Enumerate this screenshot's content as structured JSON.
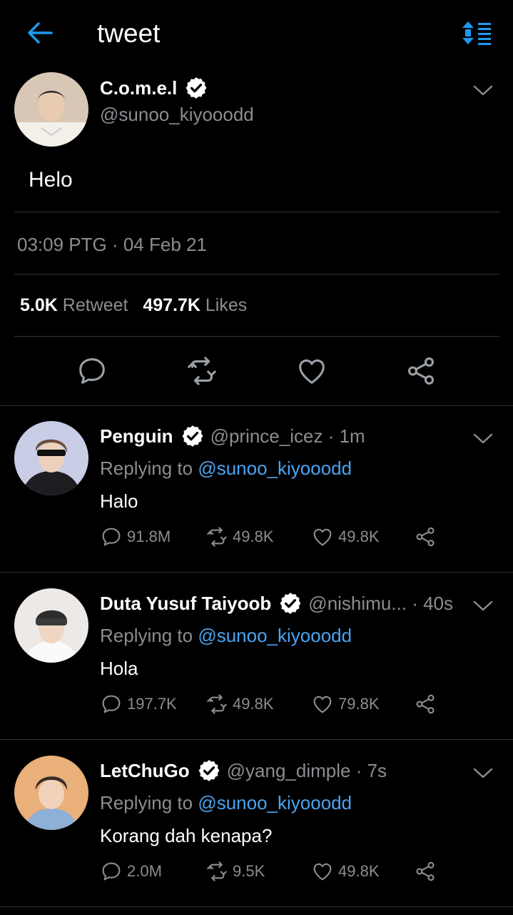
{
  "header": {
    "title": "tweet",
    "back_icon": "arrow-left-icon",
    "sort_icon": "sort-list-icon",
    "accent": "#1d9bf0"
  },
  "tweet": {
    "name": "C.o.m.e.l",
    "handle": "@sunoo_kiyooodd",
    "text": "Helo",
    "timestamp": "03:09 PTG · 04 Feb 21",
    "retweets": "5.0K",
    "retweet_label": "Retweet",
    "likes": "497.7K",
    "likes_label": "Likes"
  },
  "replies": [
    {
      "name": "Penguin",
      "handle": "@prince_icez",
      "time": "· 1m",
      "replying_label": "Replying to",
      "mention": "@sunoo_kiyooodd",
      "text": "Halo",
      "comments": "91.8M",
      "retweets": "49.8K",
      "likes": "49.8K"
    },
    {
      "name": "Duta Yusuf Taiyoob",
      "handle": "@nishimu...",
      "time": "· 40s",
      "replying_label": "Replying to",
      "mention": "@sunoo_kiyooodd",
      "text": "Hola",
      "comments": "197.7K",
      "retweets": "49.8K",
      "likes": "79.8K"
    },
    {
      "name": "LetChuGo",
      "handle": "@yang_dimple",
      "time": "· 7s",
      "replying_label": "Replying to",
      "mention": "@sunoo_kiyooodd",
      "text": "Korang dah kenapa?",
      "comments": "2.0M",
      "retweets": "9.5K",
      "likes": "49.8K"
    }
  ]
}
